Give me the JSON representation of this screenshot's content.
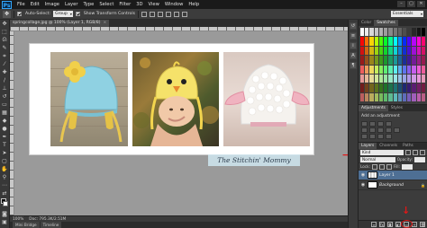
{
  "menubar": {
    "logo": "Ps",
    "items": [
      "File",
      "Edit",
      "Image",
      "Layer",
      "Type",
      "Select",
      "Filter",
      "3D",
      "View",
      "Window",
      "Help"
    ],
    "controls": [
      "–",
      "▢",
      "✕"
    ]
  },
  "options": {
    "tool_icon": "✥",
    "auto_select_label": "Auto-Select:",
    "auto_select_value": "Group",
    "transform_label": "Show Transform Controls",
    "workspace": "Essentials"
  },
  "document": {
    "tab_title": "springcollage.jpg @ 100% (Layer 1, RGB/8)",
    "watermark": "The Stitchin' Mommy"
  },
  "status": {
    "zoom": "100%",
    "doc_size": "Doc: 795.3K/2.51M"
  },
  "bottom_tabs": [
    "Mini Bridge",
    "Timeline"
  ],
  "panels": {
    "color_tabs": [
      "Color",
      "Swatches"
    ],
    "adjust_tabs": [
      "Adjustments",
      "Styles"
    ],
    "adjust_title": "Add an adjustment",
    "layers_tabs": [
      "Layers",
      "Channels",
      "Paths"
    ],
    "kind_label": "Kind",
    "blend_mode": "Normal",
    "opacity_label": "Opacity:",
    "lock_label": "Lock:",
    "fill_label": "Fill:",
    "layers": [
      {
        "name": "Layer 1",
        "selected": true
      },
      {
        "name": "Background",
        "selected": false
      }
    ]
  },
  "colors": {
    "arrow": "#e01818",
    "selected_layer": "#4e6f94"
  }
}
